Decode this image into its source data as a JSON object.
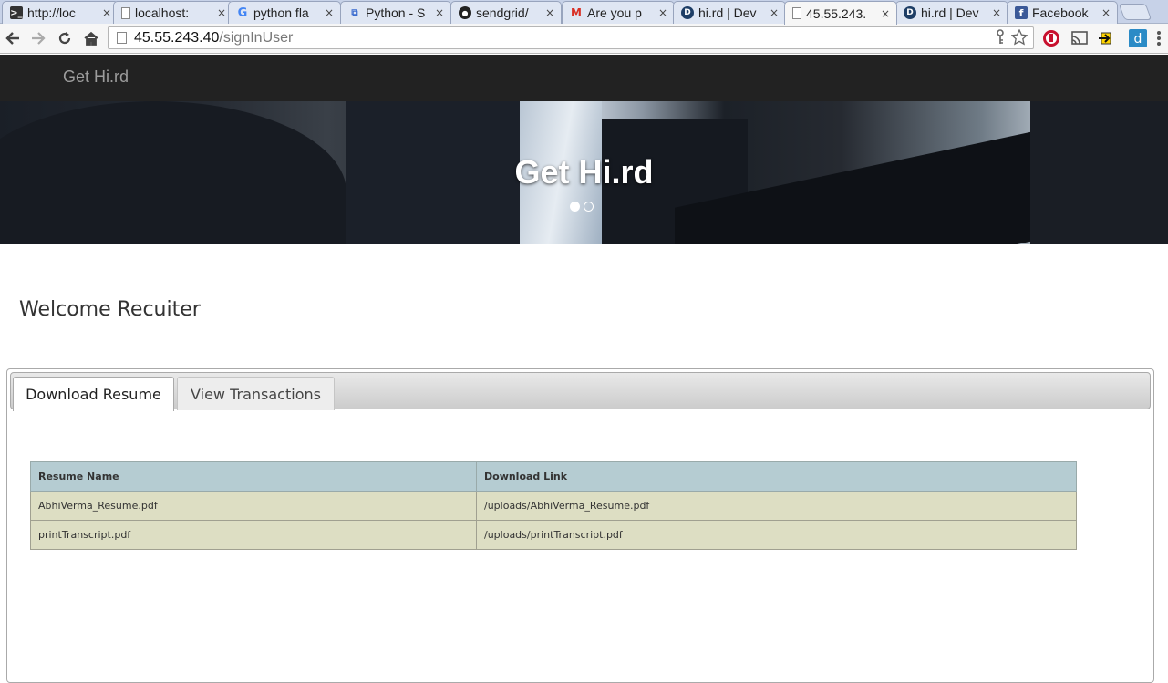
{
  "browser": {
    "tabs": [
      {
        "title": "http://loc",
        "icon": "terminal-icon"
      },
      {
        "title": "localhost:",
        "icon": "page-icon"
      },
      {
        "title": "python fla",
        "icon": "google-icon"
      },
      {
        "title": "Python - S",
        "icon": "stackoverflow-icon"
      },
      {
        "title": "sendgrid/",
        "icon": "github-icon"
      },
      {
        "title": "Are you p",
        "icon": "gmail-icon"
      },
      {
        "title": "hi.rd | Dev",
        "icon": "devpost-icon"
      },
      {
        "title": "45.55.243.",
        "icon": "page-icon"
      },
      {
        "title": "hi.rd | Dev",
        "icon": "devpost-icon"
      },
      {
        "title": "Facebook",
        "icon": "facebook-icon"
      }
    ],
    "active_tab_index": 7,
    "close_glyph": "×",
    "url_host": "45.55.243.40",
    "url_path": "/signInUser"
  },
  "site": {
    "brand": "Get Hi.rd",
    "hero_title": "Get Hi.rd",
    "carousel_active_slide": 1,
    "carousel_slide_count": 2
  },
  "content": {
    "welcome": "Welcome Recuiter",
    "tabs": [
      {
        "label": "Download Resume",
        "active": true
      },
      {
        "label": "View Transactions",
        "active": false
      }
    ],
    "table": {
      "headers": [
        "Resume Name",
        "Download Link"
      ],
      "rows": [
        [
          "AbhiVerma_Resume.pdf",
          "/uploads/AbhiVerma_Resume.pdf"
        ],
        [
          "printTranscript.pdf",
          "/uploads/printTranscript.pdf"
        ]
      ]
    }
  },
  "colors": {
    "navbar": "#222222",
    "brand_text": "#9d9d9d",
    "table_header": "#b5ccd2",
    "table_row": "#dddec3"
  }
}
